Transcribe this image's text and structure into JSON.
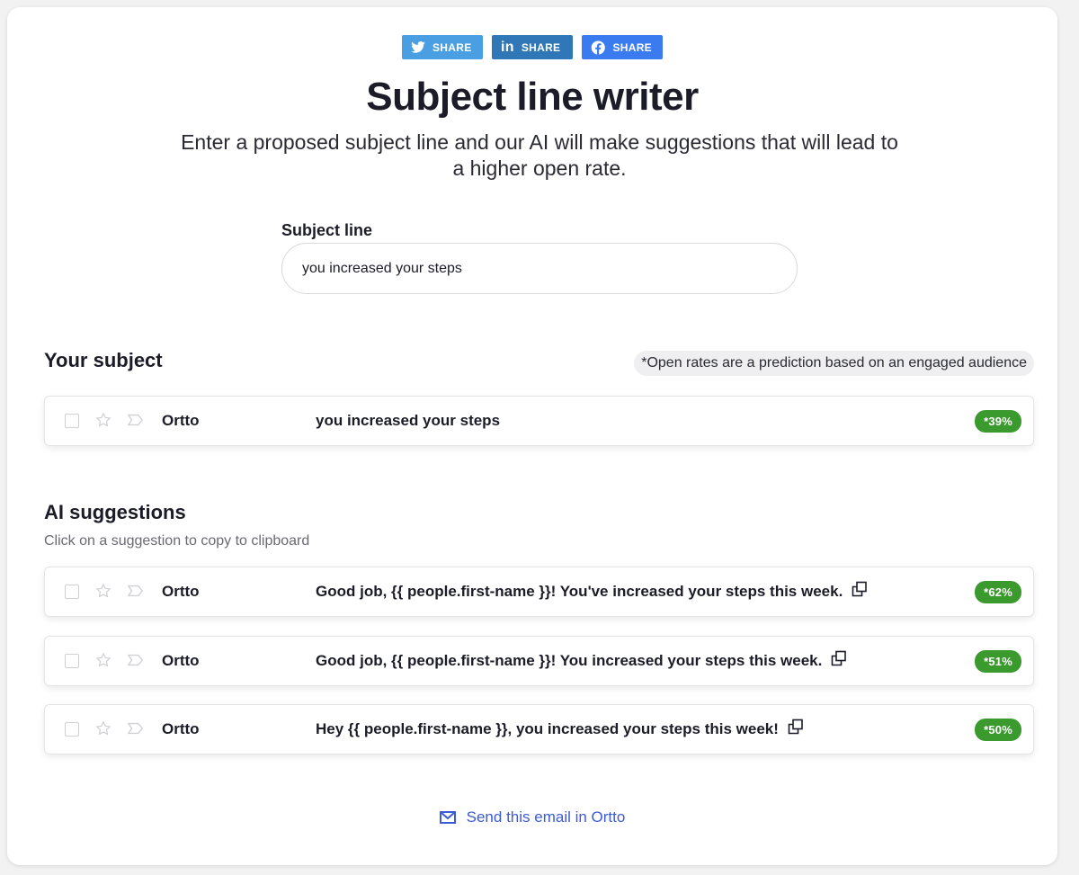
{
  "share": {
    "twitter_label": "SHARE",
    "linkedin_label": "SHARE",
    "linkedin_glyph": "in",
    "facebook_label": "SHARE"
  },
  "header": {
    "title": "Subject line writer",
    "subtitle": "Enter a proposed subject line and our AI will make suggestions that will lead to a higher open rate."
  },
  "form": {
    "label": "Subject line",
    "value": "you increased your steps"
  },
  "your_subject": {
    "heading": "Your subject",
    "note": "*Open rates are a prediction based on an engaged audience",
    "row": {
      "sender": "Ortto",
      "subject": "you increased your steps",
      "rate": "*39%"
    }
  },
  "suggestions": {
    "heading": "AI suggestions",
    "helper": "Click on a suggestion to copy to clipboard",
    "rows": [
      {
        "sender": "Ortto",
        "subject": "Good job, {{ people.first-name }}! You've increased your steps this week.",
        "rate": "*62%"
      },
      {
        "sender": "Ortto",
        "subject": "Good job, {{ people.first-name }}! You increased your steps this week.",
        "rate": "*51%"
      },
      {
        "sender": "Ortto",
        "subject": "Hey {{ people.first-name }}, you increased your steps this week!",
        "rate": "*50%"
      }
    ]
  },
  "footer": {
    "send_label": "Send this email in Ortto"
  },
  "colors": {
    "twitter": "#4a9fe3",
    "linkedin": "#2f77b6",
    "facebook": "#3b7bf0",
    "rate_badge": "#3a9a2e",
    "link": "#3c5bd6"
  },
  "icons": [
    "twitter-icon",
    "linkedin-icon",
    "facebook-icon",
    "checkbox-icon",
    "star-icon",
    "label-tag-icon",
    "copy-icon",
    "mail-icon"
  ]
}
